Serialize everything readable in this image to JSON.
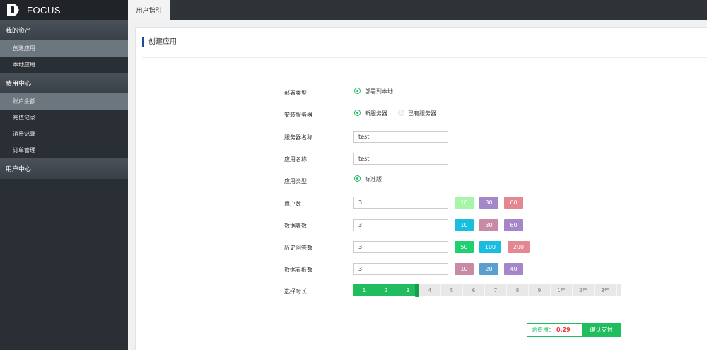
{
  "brand": {
    "name": "FOCUS"
  },
  "sidebar": {
    "groups": [
      {
        "label": "我的资产",
        "items": [
          {
            "label": "创建应用",
            "active": true
          },
          {
            "label": "本地应用"
          }
        ]
      },
      {
        "label": "费用中心",
        "items": [
          {
            "label": "账户余额",
            "active": true
          },
          {
            "label": "充值记录"
          },
          {
            "label": "消费记录"
          },
          {
            "label": "订单管理"
          }
        ]
      },
      {
        "label": "用户中心",
        "items": []
      }
    ]
  },
  "tabs": [
    {
      "label": "用户指引"
    }
  ],
  "panel": {
    "title": "创建应用"
  },
  "form": {
    "deploy_type": {
      "label": "部署类型",
      "options": [
        "部署到本地"
      ]
    },
    "server_install": {
      "label": "安装服务器",
      "options": [
        "新服务器",
        "已有服务器"
      ]
    },
    "server_name": {
      "label": "服务器名称",
      "value": "test"
    },
    "app_name": {
      "label": "应用名称",
      "value": "test"
    },
    "app_type": {
      "label": "应用类型",
      "options": [
        "标准版"
      ]
    },
    "users": {
      "label": "用户数",
      "value": "3",
      "presets": [
        "10",
        "30",
        "60"
      ],
      "colors": [
        "#a6f5a8",
        "#a387c9",
        "#e38790"
      ]
    },
    "tables": {
      "label": "数据表数",
      "value": "3",
      "presets": [
        "10",
        "30",
        "60"
      ],
      "colors": [
        "#18bde0",
        "#c98aa6",
        "#a387c9"
      ]
    },
    "history": {
      "label": "历史问答数",
      "value": "3",
      "presets": [
        "50",
        "100",
        "200"
      ],
      "colors": [
        "#1fcf70",
        "#18bde0",
        "#e38790"
      ]
    },
    "dashboards": {
      "label": "数据看板数",
      "value": "3",
      "presets": [
        "10",
        "20",
        "40"
      ],
      "colors": [
        "#c98aa6",
        "#5b9fcf",
        "#a387c9"
      ]
    },
    "duration": {
      "label": "选择时长",
      "ticks": [
        "1",
        "2",
        "3",
        "4",
        "5",
        "6",
        "7",
        "8",
        "9",
        "1年",
        "2年",
        "3年"
      ],
      "selected": 3
    }
  },
  "total": {
    "label": "总费用：",
    "value": "0.29",
    "button": "确认支付"
  }
}
